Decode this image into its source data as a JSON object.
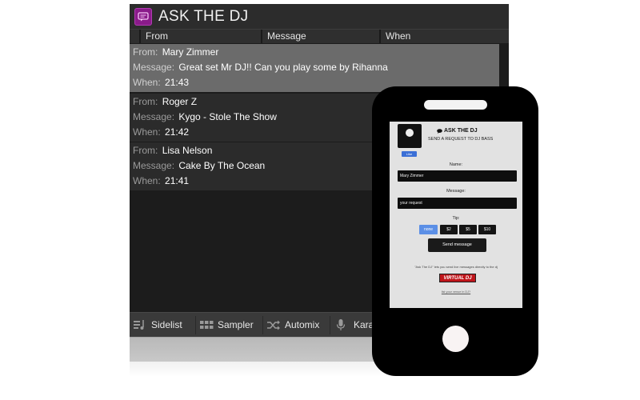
{
  "app": {
    "title": "ASK THE DJ"
  },
  "columns": {
    "from": "From",
    "message": "Message",
    "when": "When"
  },
  "labels": {
    "from": "From:",
    "message": "Message:",
    "when": "When:"
  },
  "messages": [
    {
      "from": "Mary Zimmer",
      "message": "Great set Mr DJ!! Can you play some by Rihanna",
      "when": "21:43",
      "selected": true
    },
    {
      "from": "Roger Z",
      "message": "Kygo - Stole The Show",
      "when": "21:42",
      "selected": false
    },
    {
      "from": "Lisa Nelson",
      "message": "Cake By The Ocean",
      "when": "21:41",
      "selected": false
    }
  ],
  "bottom_tabs": [
    {
      "label": "Sidelist",
      "icon": "sidelist-icon"
    },
    {
      "label": "Sampler",
      "icon": "sampler-grid-icon"
    },
    {
      "label": "Automix",
      "icon": "shuffle-icon"
    },
    {
      "label": "Karao",
      "icon": "microphone-icon"
    }
  ],
  "phone": {
    "title": "ASK THE DJ",
    "subtitle": "SEND A REQUEST TO DJ BASS",
    "like_label": "Like",
    "name_label": "Name:",
    "name_value": "Mary Zimmer",
    "message_label": "Message:",
    "message_placeholder": "your request",
    "tip_label": "Tip:",
    "tips": [
      "none",
      "$2",
      "$5",
      "$10"
    ],
    "selected_tip": "none",
    "send_label": "Send message",
    "note": "\"Ask The DJ\" lets you send live messages directly to the dj",
    "vdj_logo": "VIRTUAL DJ",
    "footer": "list your venue in DJ?"
  },
  "colors": {
    "selected_row": "#6b6b6b",
    "row": "#2b2b2b",
    "app_icon": "#8a1b8a",
    "tip_selected": "#5b8fe6"
  }
}
